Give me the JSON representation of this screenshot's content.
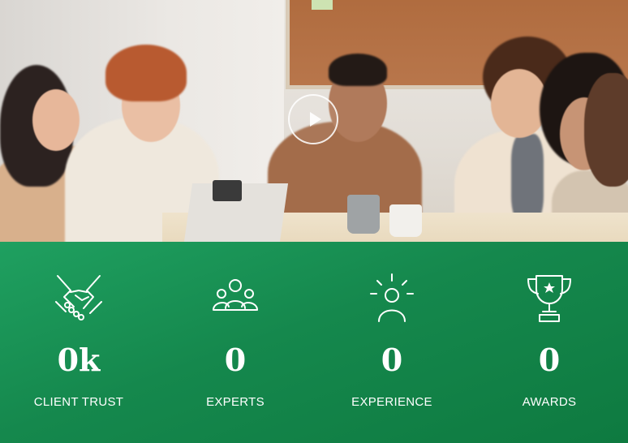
{
  "hero": {
    "play_icon": "play-icon"
  },
  "stats": [
    {
      "icon": "handshake-icon",
      "value": "0k",
      "label": "CLIENT TRUST"
    },
    {
      "icon": "team-icon",
      "value": "0",
      "label": "EXPERTS"
    },
    {
      "icon": "idea-person-icon",
      "value": "0",
      "label": "EXPERIENCE"
    },
    {
      "icon": "trophy-icon",
      "value": "0",
      "label": "AWARDS"
    }
  ],
  "colors": {
    "stats_background": "#15884d",
    "text": "#ffffff"
  }
}
